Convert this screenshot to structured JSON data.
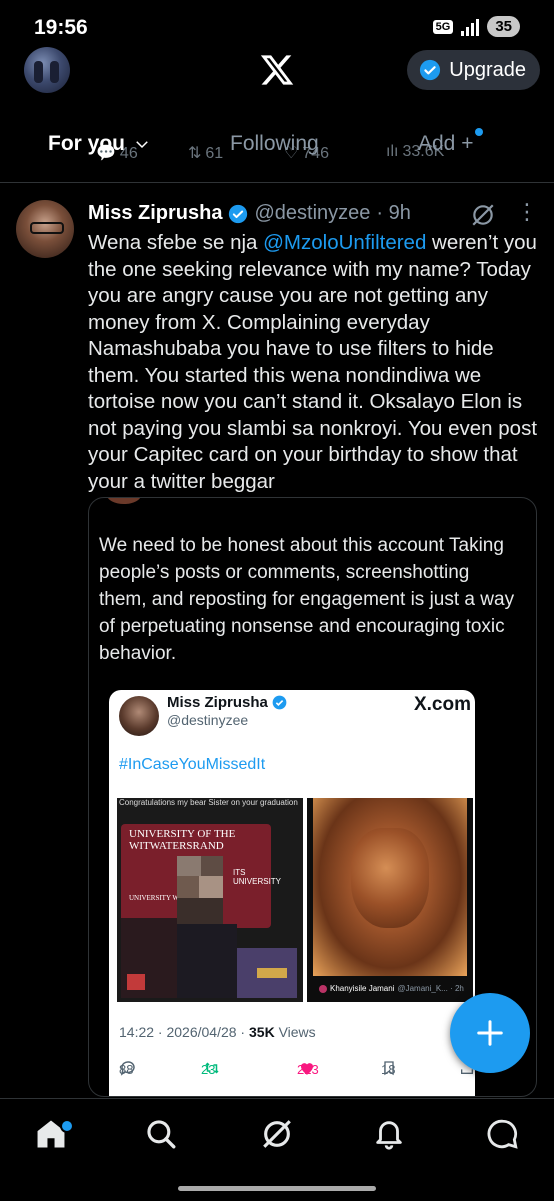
{
  "status_bar": {
    "time": "19:56",
    "network": "5G",
    "battery": "35"
  },
  "header": {
    "upgrade_label": "Upgrade",
    "icons": [
      "profile-avatar",
      "x-logo",
      "verified-icon"
    ]
  },
  "tabs": {
    "for_you": "For you",
    "following": "Following",
    "add": "Add +"
  },
  "previous_tweet_stats": {
    "replies": "46",
    "reposts": "61",
    "likes": "746",
    "views": "33.6K"
  },
  "tweet": {
    "author_name": "Miss Ziprusha",
    "author_handle": "@destinyzee",
    "time": "· 9h",
    "text_before_mention": "Wena sfebe se nja ",
    "mention": "@MzoloUnfiltered",
    "text_after_mention": " weren’t you the one seeking relevance with my name? Today you are angry cause you are not getting any money from X. Complaining everyday Namashubaba you have to use filters to hide them. You started this wena nondindiwa we tortoise now you can’t stand it. Oksalayo Elon is not paying you slambi sa nonkroyi. You even post your Capitec card on your birthday to show that your a twitter beggar"
  },
  "quote": {
    "text": "We need to be honest about this account Taking people’s posts or comments, screenshotting them, and reposting for engagement is just a way of perpetuating nonsense and encouraging toxic behavior."
  },
  "embedded_screenshot": {
    "name": "Miss Ziprusha",
    "handle": "@destinyzee",
    "brand": "X.com",
    "hashtag": "#InCaseYouMissedIt",
    "caption": "Congratulations my bear Sister on your graduation",
    "board_text": "UNIVERSITY OF THE WITWATERSRAND",
    "board_small": "UNIVERSITY WITWATER",
    "its_text": "ITS UNIVERSITY",
    "credit_name": "Khanyisile Jamani",
    "credit_meta": "@Jamani_K... · 2h",
    "timestamp": "14:22 · 2026/04/28 · ",
    "views_count": "35K",
    "views_label": " Views",
    "replies": "88",
    "reposts": "23",
    "likes": "223",
    "bookmarks": "18"
  },
  "colors": {
    "accent": "#1d9bf0",
    "background": "#000000",
    "like": "#f91880",
    "repost": "#00ba7c"
  },
  "bottom_nav": [
    "home-icon",
    "search-icon",
    "grok-icon",
    "notifications-icon",
    "messages-icon"
  ]
}
